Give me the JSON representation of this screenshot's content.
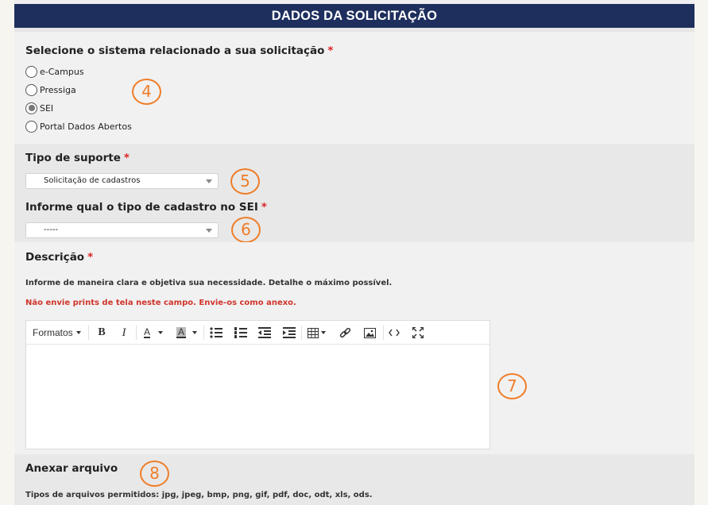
{
  "header": {
    "title": "DADOS DA SOLICITAÇÃO"
  },
  "sistema": {
    "label": "Selecione o sistema relacionado a sua solicitação",
    "required_mark": "*",
    "options": [
      {
        "label": "e-Campus",
        "checked": false
      },
      {
        "label": "Pressiga",
        "checked": false
      },
      {
        "label": "SEI",
        "checked": true
      },
      {
        "label": "Portal Dados Abertos",
        "checked": false
      }
    ]
  },
  "suporte": {
    "label": "Tipo de suporte",
    "required_mark": "*",
    "value": "Solicitação de cadastros"
  },
  "cadastro": {
    "label": "Informe qual o tipo de cadastro no SEI",
    "required_mark": "*",
    "value": "-----"
  },
  "descricao": {
    "label": "Descrição",
    "required_mark": "*",
    "hint": "Informe de maneira clara e objetiva sua necessidade. Detalhe o máximo possível.",
    "warning": "Não envie prints de tela neste campo. Envie-os como anexo.",
    "toolbar": {
      "formats_label": "Formatos",
      "bold": "B",
      "italic": "I",
      "text_color": "A",
      "bg_color": "A"
    }
  },
  "anexo": {
    "label": "Anexar arquivo",
    "hint": "Tipos de arquivos permitidos: jpg, jpeg, bmp, png, gif, pdf, doc, odt, xls, ods."
  },
  "annotations": [
    "4",
    "5",
    "6",
    "7",
    "8"
  ],
  "colors": {
    "header_bg": "#1e2f5e",
    "required": "#dd2222",
    "warning": "#d0342c",
    "annotation": "#ef7d28"
  }
}
